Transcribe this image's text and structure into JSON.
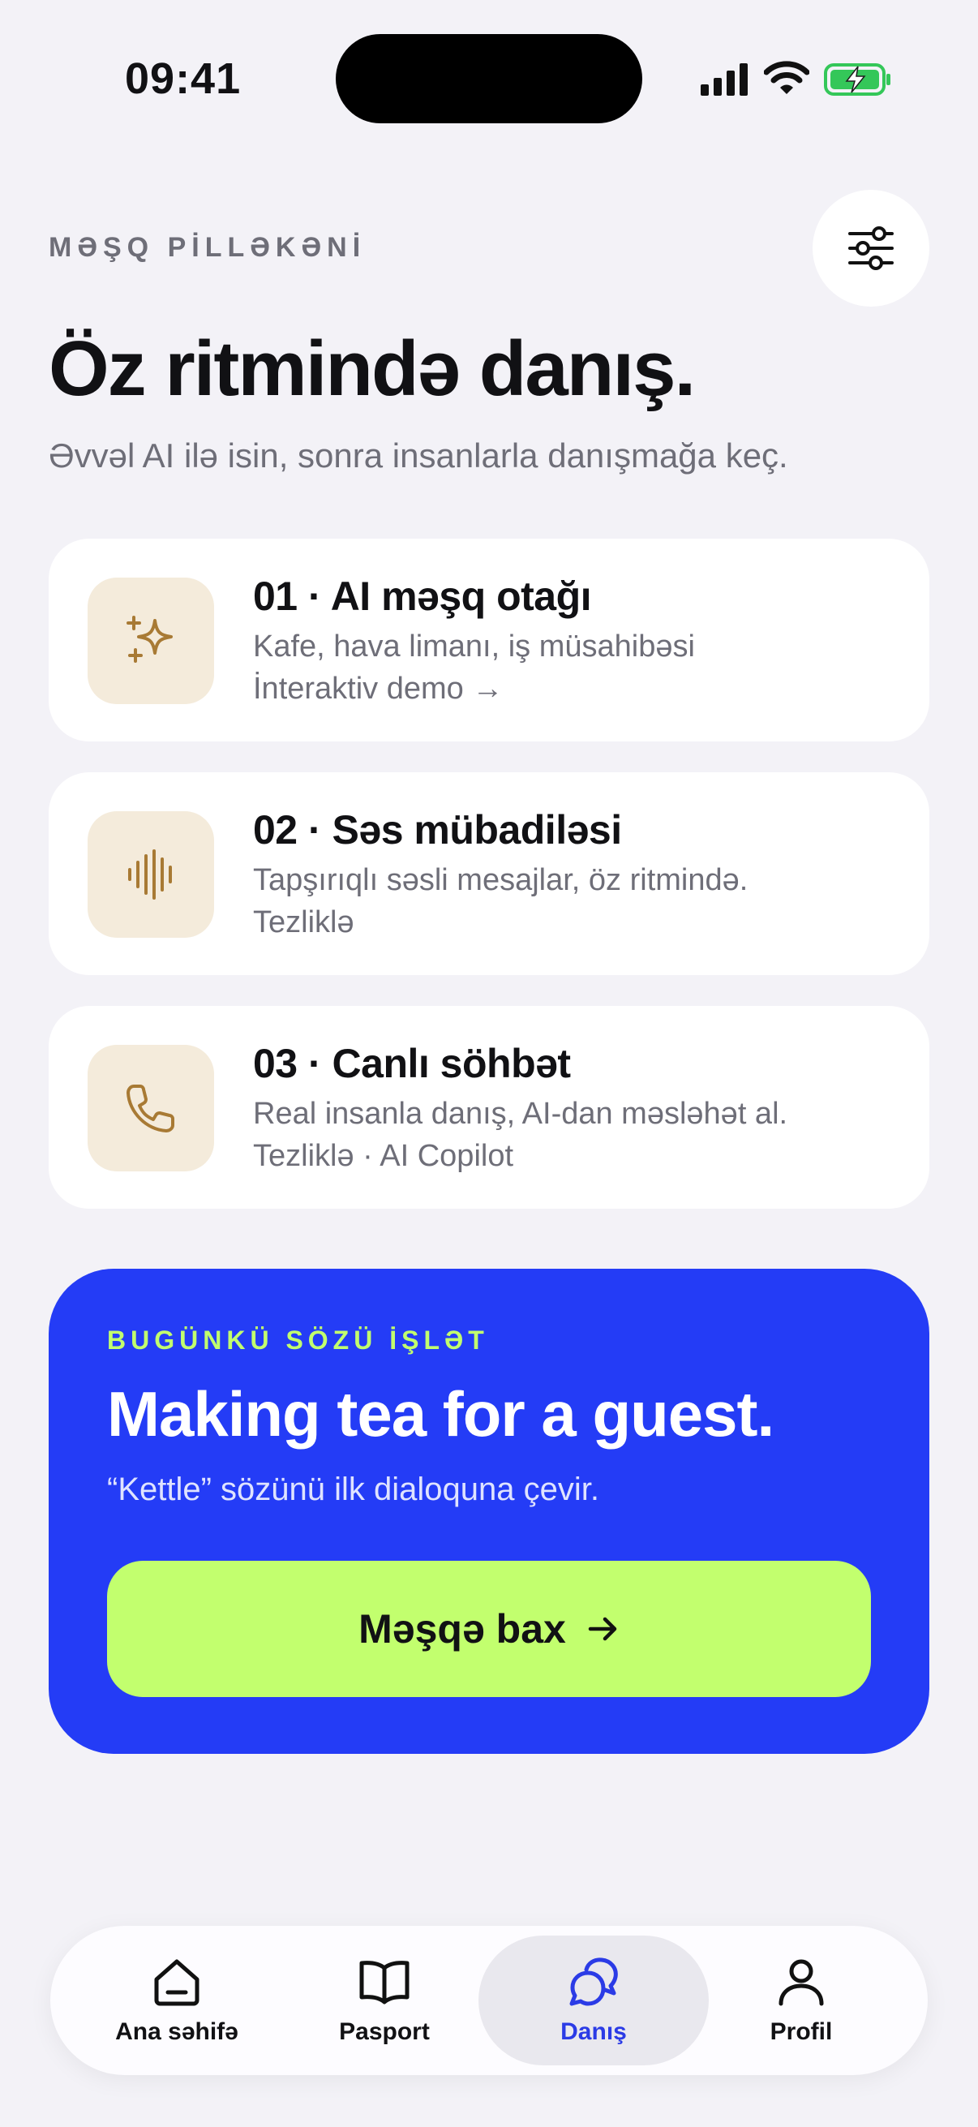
{
  "status_bar": {
    "time": "09:41"
  },
  "header": {
    "eyebrow": "MƏŞQ PİLLƏKƏNİ",
    "title": "Öz ritmində danış.",
    "subtitle": "Əvvəl AI ilə isin, sonra insanlarla danışmağa keç.",
    "filter_icon": "sliders-icon"
  },
  "cards": [
    {
      "title": "01 · AI məşq otağı",
      "desc": "Kafe, hava limanı, iş müsahibəsi",
      "meta": "İnteraktiv demo →",
      "icon": "sparkles-icon"
    },
    {
      "title": "02 · Səs mübadiləsi",
      "desc": "Tapşırıqlı səsli mesajlar, öz ritmində.",
      "meta": "Tezliklə",
      "icon": "waveform-icon"
    },
    {
      "title": "03 · Canlı söhbət",
      "desc": "Real insanla danış, AI-dan məsləhət al.",
      "meta": "Tezliklə · AI Copilot",
      "icon": "phone-icon"
    }
  ],
  "promo": {
    "eyebrow": "BUGÜNKÜ SÖZÜ İŞLƏT",
    "title": "Making tea for a guest.",
    "desc": "“Kettle” sözünü ilk dialoquna çevir.",
    "cta": "Məşqə bax",
    "cta_icon": "arrow-right-icon"
  },
  "tabs": [
    {
      "label": "Ana səhifə",
      "icon": "home-icon",
      "active": false
    },
    {
      "label": "Pasport",
      "icon": "book-icon",
      "active": false
    },
    {
      "label": "Danış",
      "icon": "chat-bubbles-icon",
      "active": true
    },
    {
      "label": "Profil",
      "icon": "person-icon",
      "active": false
    }
  ],
  "colors": {
    "background": "#f3f2f7",
    "accent_blue": "#243cf6",
    "accent_lime": "#c2ff6e",
    "icon_bg": "#f4ebdb",
    "icon_gold": "#a87a34",
    "battery_green": "#34c759"
  }
}
